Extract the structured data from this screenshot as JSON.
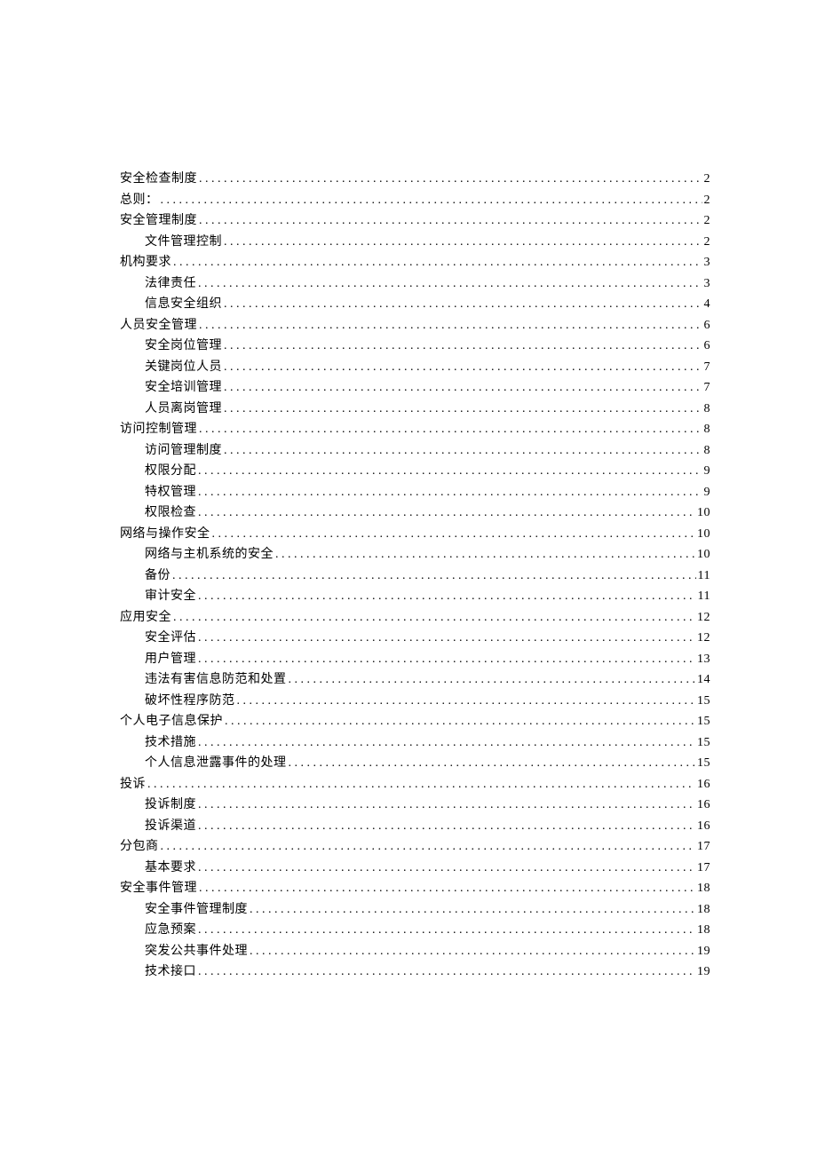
{
  "toc": [
    {
      "level": 1,
      "title": "安全检查制度",
      "page": "2"
    },
    {
      "level": 1,
      "title": "总则：",
      "page": "2"
    },
    {
      "level": 1,
      "title": "安全管理制度",
      "page": "2"
    },
    {
      "level": 2,
      "title": "文件管理控制",
      "page": "2"
    },
    {
      "level": 1,
      "title": "机构要求",
      "page": "3"
    },
    {
      "level": 2,
      "title": "法律责任",
      "page": "3"
    },
    {
      "level": 2,
      "title": "信息安全组织",
      "page": "4"
    },
    {
      "level": 1,
      "title": "人员安全管理",
      "page": "6"
    },
    {
      "level": 2,
      "title": "安全岗位管理",
      "page": "6"
    },
    {
      "level": 2,
      "title": "关键岗位人员",
      "page": "7"
    },
    {
      "level": 2,
      "title": "安全培训管理",
      "page": "7"
    },
    {
      "level": 2,
      "title": "人员离岗管理",
      "page": "8"
    },
    {
      "level": 1,
      "title": "访问控制管理",
      "page": "8"
    },
    {
      "level": 2,
      "title": "访问管理制度",
      "page": "8"
    },
    {
      "level": 2,
      "title": "权限分配",
      "page": "9"
    },
    {
      "level": 2,
      "title": "特权管理",
      "page": "9"
    },
    {
      "level": 2,
      "title": "权限检查",
      "page": "10"
    },
    {
      "level": 1,
      "title": "网络与操作安全",
      "page": "10"
    },
    {
      "level": 2,
      "title": "网络与主机系统的安全",
      "page": "10"
    },
    {
      "level": 2,
      "title": "备份",
      "page": "11"
    },
    {
      "level": 2,
      "title": "审计安全",
      "page": "11"
    },
    {
      "level": 1,
      "title": "应用安全",
      "page": "12"
    },
    {
      "level": 2,
      "title": "安全评估",
      "page": "12"
    },
    {
      "level": 2,
      "title": "用户管理",
      "page": "13"
    },
    {
      "level": 2,
      "title": "违法有害信息防范和处置",
      "page": "14"
    },
    {
      "level": 2,
      "title": "破坏性程序防范",
      "page": "15"
    },
    {
      "level": 1,
      "title": "个人电子信息保护",
      "page": "15"
    },
    {
      "level": 2,
      "title": "技术措施",
      "page": "15"
    },
    {
      "level": 2,
      "title": "个人信息泄露事件的处理",
      "page": "15"
    },
    {
      "level": 1,
      "title": "投诉",
      "page": "16"
    },
    {
      "level": 2,
      "title": "投诉制度",
      "page": "16"
    },
    {
      "level": 2,
      "title": "投诉渠道",
      "page": "16"
    },
    {
      "level": 1,
      "title": "分包商",
      "page": "17"
    },
    {
      "level": 2,
      "title": "基本要求",
      "page": "17"
    },
    {
      "level": 1,
      "title": "安全事件管理",
      "page": "18"
    },
    {
      "level": 2,
      "title": "安全事件管理制度",
      "page": "18"
    },
    {
      "level": 2,
      "title": "应急预案",
      "page": "18"
    },
    {
      "level": 2,
      "title": "突发公共事件处理",
      "page": "19"
    },
    {
      "level": 2,
      "title": "技术接口",
      "page": "19"
    }
  ]
}
